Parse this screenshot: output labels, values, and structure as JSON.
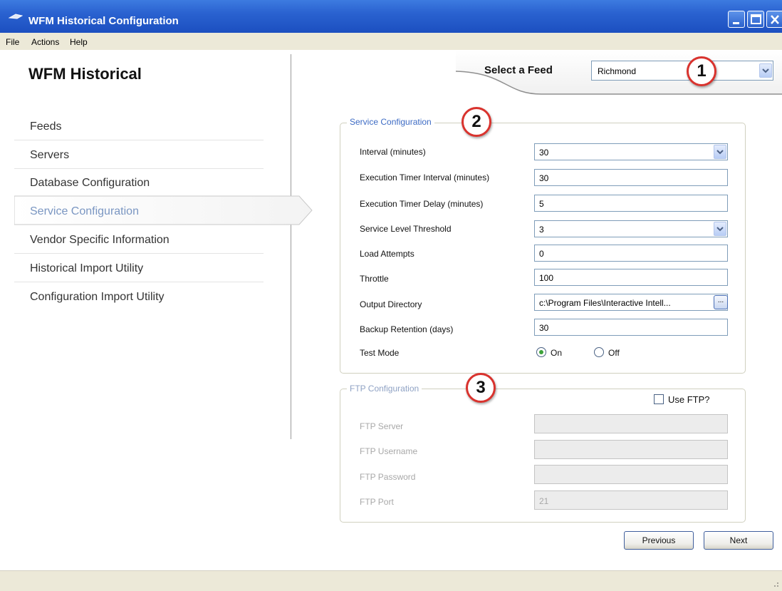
{
  "window": {
    "title": "WFM Historical Configuration"
  },
  "menu": {
    "items": [
      "File",
      "Actions",
      "Help"
    ]
  },
  "nav": {
    "title": "WFM Historical",
    "items": [
      {
        "label": "Feeds"
      },
      {
        "label": "Servers"
      },
      {
        "label": "Database Configuration"
      },
      {
        "label": "Service Configuration",
        "selected": true
      },
      {
        "label": "Vendor Specific Information"
      },
      {
        "label": "Historical Import Utility"
      },
      {
        "label": "Configuration Import Utility"
      }
    ]
  },
  "feed": {
    "label": "Select a Feed",
    "value": "Richmond"
  },
  "callouts": [
    "1",
    "2",
    "3"
  ],
  "service": {
    "legend": "Service Configuration",
    "fields": [
      {
        "label": "Interval (minutes)",
        "value": "30"
      },
      {
        "label": "Execution Timer Interval (minutes)",
        "value": "30"
      },
      {
        "label": "Execution Timer Delay (minutes)",
        "value": "5"
      },
      {
        "label": "Service Level Threshold",
        "value": "3"
      },
      {
        "label": "Load Attempts",
        "value": "0"
      },
      {
        "label": "Throttle",
        "value": "100"
      },
      {
        "label": "Output Directory",
        "value": "c:\\Program Files\\Interactive Intell..."
      },
      {
        "label": "Backup Retention (days)",
        "value": "30"
      }
    ],
    "browse_label": "...",
    "test_mode": {
      "label": "Test Mode",
      "on_label": "On",
      "off_label": "Off",
      "selected": "On"
    }
  },
  "ftp": {
    "legend": "FTP Configuration",
    "use_ftp_label": "Use FTP?",
    "use_ftp_checked": false,
    "fields": [
      {
        "label": "FTP Server",
        "value": ""
      },
      {
        "label": "FTP Username",
        "value": ""
      },
      {
        "label": "FTP Password",
        "value": ""
      },
      {
        "label": "FTP Port",
        "value": "21"
      }
    ]
  },
  "buttons": {
    "previous": "Previous",
    "next": "Next"
  },
  "colors": {
    "titlebar": "#2a62d0",
    "accent": "#3d6bc4",
    "callout_border": "#d9332e",
    "selected_nav_text": "#7a96c2"
  }
}
